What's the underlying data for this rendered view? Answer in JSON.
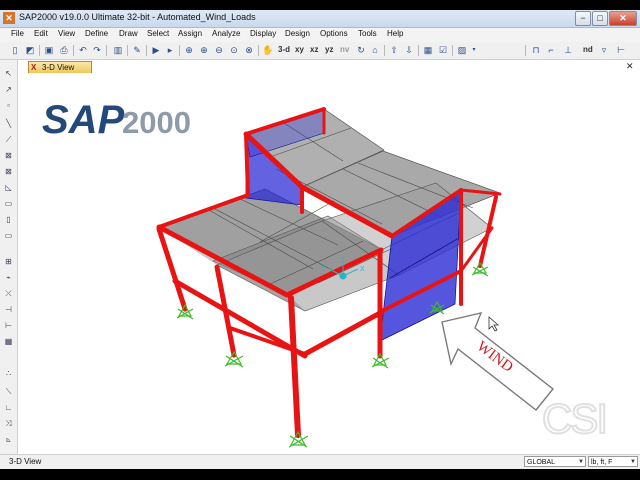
{
  "window": {
    "title": "SAP2000 v19.0.0 Ultimate 32-bit - Automated_Wind_Loads",
    "app_icon": "sap-logo-icon",
    "controls": [
      "−",
      "□",
      "✕"
    ]
  },
  "menu": [
    "File",
    "Edit",
    "View",
    "Define",
    "Draw",
    "Select",
    "Assign",
    "Analyze",
    "Display",
    "Design",
    "Options",
    "Tools",
    "Help"
  ],
  "toolbar": {
    "view_buttons": [
      "3-d",
      "xy",
      "xz",
      "yz",
      "nv"
    ],
    "right_label": "nd"
  },
  "view_tab": {
    "close": "X",
    "label": "3-D View"
  },
  "canvas": {
    "logo_sap": "SAP",
    "logo_num": "2000",
    "wind_label": "WIND",
    "axes": {
      "x": "X",
      "y": "Y",
      "z": "Z"
    },
    "watermark": "CSI"
  },
  "status": {
    "view_name": "3-D View",
    "coord_system": "GLOBAL",
    "units": "lb, ft, F"
  },
  "colors": {
    "frame": "#e81414",
    "slab": "#8a8a8a",
    "wall": "#3030d8",
    "support": "#3dbb2a",
    "logo": "#23497a"
  }
}
